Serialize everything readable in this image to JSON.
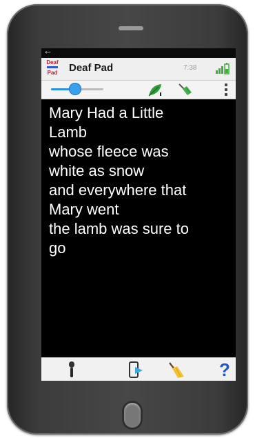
{
  "status": {
    "time": "7:38"
  },
  "app": {
    "icon_top": "Deaf",
    "icon_bottom": "Pad",
    "title": "Deaf Pad"
  },
  "toolbar": {
    "font_size_level": 0.46
  },
  "document": {
    "text": "Mary Had a Little\nLamb\nwhose fleece was\nwhite as snow\nand everywhere that\nMary went\nthe lamb was sure to\ngo"
  },
  "bottom": {
    "help_label": "?"
  },
  "colors": {
    "accent": "#2b8fe0",
    "help": "#1f57c9",
    "screen_bg": "#000000",
    "text": "#ffffff"
  },
  "icons": [
    "back-arrow-icon",
    "app-logo-icon",
    "signal-icon",
    "battery-icon",
    "font-size-slider",
    "leaf-icon",
    "broom-icon",
    "overflow-menu-icon",
    "microphone-icon",
    "transfer-icon",
    "eraser-icon",
    "help-icon"
  ]
}
